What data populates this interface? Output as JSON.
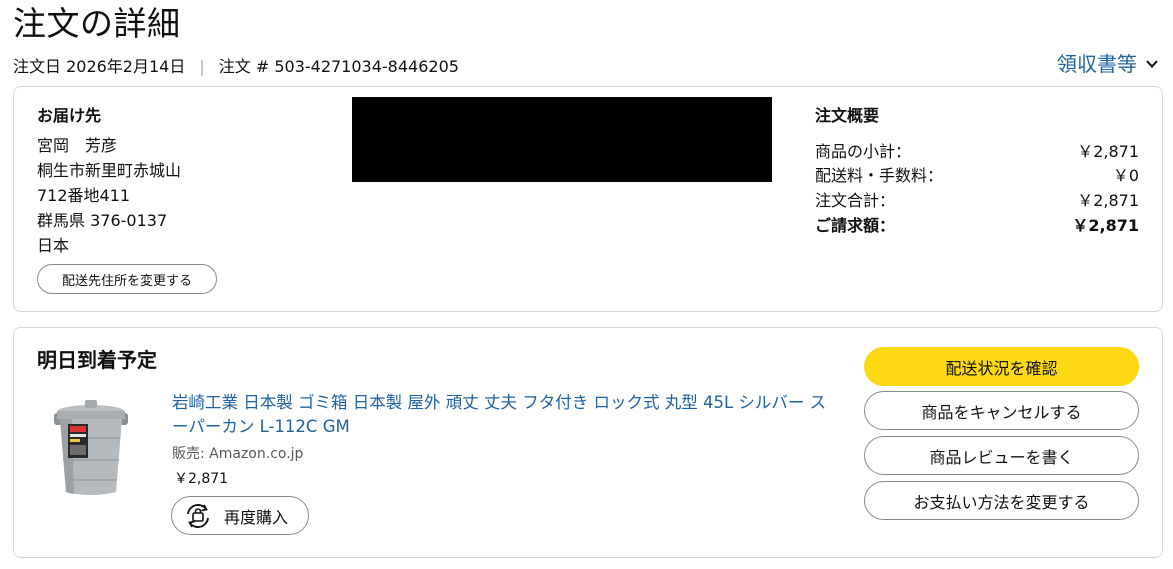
{
  "page": {
    "title": "注文の詳細",
    "order_date": "注文日 2026年2月14日",
    "separator": "|",
    "order_number": "注文 # 503-4271034-8446205",
    "invoice_link": "領収書等"
  },
  "shipping": {
    "heading": "お届け先",
    "lines": [
      "宮岡　芳彦",
      "桐生市新里町赤城山",
      "712番地411",
      "群馬県 376-0137",
      "日本"
    ],
    "change_button": "配送先住所を変更する"
  },
  "summary": {
    "heading": "注文概要",
    "rows": [
      {
        "label": "商品の小計：",
        "value": "￥2,871"
      },
      {
        "label": "配送料・手数料：",
        "value": "￥0"
      },
      {
        "label": "注文合計：",
        "value": "￥2,871"
      },
      {
        "label": "ご請求額：",
        "value": "￥2,871"
      }
    ]
  },
  "shipment": {
    "heading": "明日到着予定",
    "product": {
      "title": "岩崎工業 日本製 ゴミ箱 日本製 屋外 頑丈 丈夫 フタ付き ロック式 丸型 45L シルバー スーパーカン L-112C GM",
      "seller": "販売: Amazon.co.jp",
      "price": "￥2,871",
      "rebuy_button": "再度購入"
    },
    "actions": {
      "track": "配送状況を確認",
      "cancel": "商品をキャンセルする",
      "review": "商品レビューを書く",
      "payment": "お支払い方法を変更する"
    }
  },
  "colors": {
    "link": "#2162a1",
    "primary_button": "#ffd814",
    "border": "#d5d9d9"
  },
  "icons": {
    "invoice_chevron": "chevron-down-icon",
    "rebuy": "rebuy-cycle-icon",
    "product": "trash-can-product-image"
  }
}
